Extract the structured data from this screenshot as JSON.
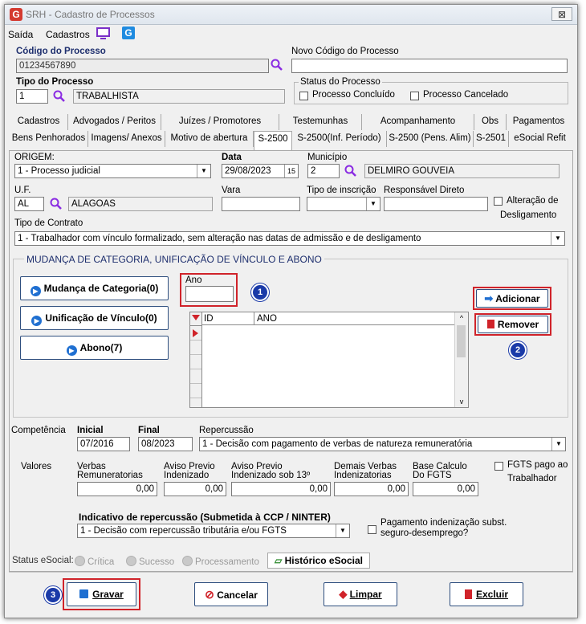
{
  "window": {
    "title": "SRH - Cadastro de Processos",
    "close": "⊠"
  },
  "menu": {
    "saida": "Saída",
    "cadastros": "Cadastros"
  },
  "processo": {
    "codigo_label": "Código do Processo",
    "codigo_value": "01234567890",
    "novo_codigo_label": "Novo Código do Processo",
    "novo_codigo_value": "",
    "tipo_label": "Tipo do Processo",
    "tipo_code": "1",
    "tipo_desc": "TRABALHISTA",
    "status_label": "Status do Processo",
    "concluido": "Processo Concluído",
    "cancelado": "Processo Cancelado"
  },
  "tabs_row1": [
    "Cadastros",
    "Advogados / Peritos",
    "Juízes / Promotores",
    "Testemunhas",
    "Acompanhamento",
    "Obs",
    "Pagamentos"
  ],
  "tabs_row2": [
    "Bens Penhorados",
    "Imagens/ Anexos",
    "Motivo de abertura",
    "S-2500",
    "S-2500(Inf. Período)",
    "S-2500 (Pens. Alim)",
    "S-2501",
    "eSocial Refit"
  ],
  "s2500": {
    "origem_label": "ORIGEM:",
    "origem_value": "1 - Processo judicial",
    "data_label": "Data",
    "data_value": "29/08/2023",
    "municipio_label": "Município",
    "municipio_code": "2",
    "municipio_name": "DELMIRO GOUVEIA",
    "uf_label": "U.F.",
    "uf_code": "AL",
    "uf_name": "ALAGOAS",
    "vara_label": "Vara",
    "tipo_inscricao_label": "Tipo de inscrição",
    "responsavel_label": "Responsável Direto",
    "alteracao_label_1": "Alteração de",
    "alteracao_label_2": "Desligamento",
    "tipo_contrato_label": "Tipo de Contrato",
    "tipo_contrato_value": "1 - Trabalhador com vínculo formalizado, sem alteração nas datas de admissão e de desligamento"
  },
  "mudanca": {
    "group_title": "MUDANÇA DE CATEGORIA, UNIFICAÇÃO DE VÍNCULO E ABONO",
    "btn_categoria": "Mudança de Categoria(0)",
    "btn_unificacao": "Unificação de Vínculo(0)",
    "btn_abono": "Abono(7)",
    "ano_label": "Ano",
    "grid_cols": [
      "ID",
      "ANO"
    ],
    "btn_adicionar": "Adicionar",
    "btn_remover": "Remover"
  },
  "competencia": {
    "label": "Competência",
    "inicial_label": "Inicial",
    "inicial_value": "07/2016",
    "final_label": "Final",
    "final_value": "08/2023",
    "repercussao_label": "Repercussão",
    "repercussao_value": "1 - Decisão com pagamento de verbas de natureza remuneratória"
  },
  "valores": {
    "label": "Valores",
    "verbas_1": "Verbas",
    "verbas_2": "Remuneratorias",
    "verbas_value": "0,00",
    "aviso_1": "Aviso Previo",
    "aviso_2": "Indenizado",
    "aviso_value": "0,00",
    "aviso13_1": "Aviso Previo",
    "aviso13_2": "Indenizado sob 13º",
    "aviso13_value": "0,00",
    "demais_1": "Demais Verbas",
    "demais_2": "Indenizatorias",
    "demais_value": "0,00",
    "base_1": "Base Calculo",
    "base_2": "Do FGTS",
    "base_value": "0,00",
    "fgts_1": "FGTS pago ao",
    "fgts_2": "Trabalhador"
  },
  "indicativo": {
    "label": "Indicativo de repercussão (Submetida à CCP / NINTER)",
    "value": "1 - Decisão com repercussão tributária e/ou FGTS",
    "pagamento_1": "Pagamento indenização subst.",
    "pagamento_2": "seguro-desemprego?"
  },
  "status_esocial": {
    "label": "Status eSocial:",
    "critica": "Crítica",
    "sucesso": "Sucesso",
    "processamento": "Processamento",
    "historico": "Histórico eSocial"
  },
  "footer": {
    "gravar": "Gravar",
    "cancelar": "Cancelar",
    "limpar": "Limpar",
    "excluir": "Excluir"
  },
  "badges": [
    "1",
    "2",
    "3"
  ],
  "colors": {
    "accent_red": "#d0232a",
    "badge_blue": "#1a3aa8",
    "label_blue": "#1e2f6e"
  }
}
